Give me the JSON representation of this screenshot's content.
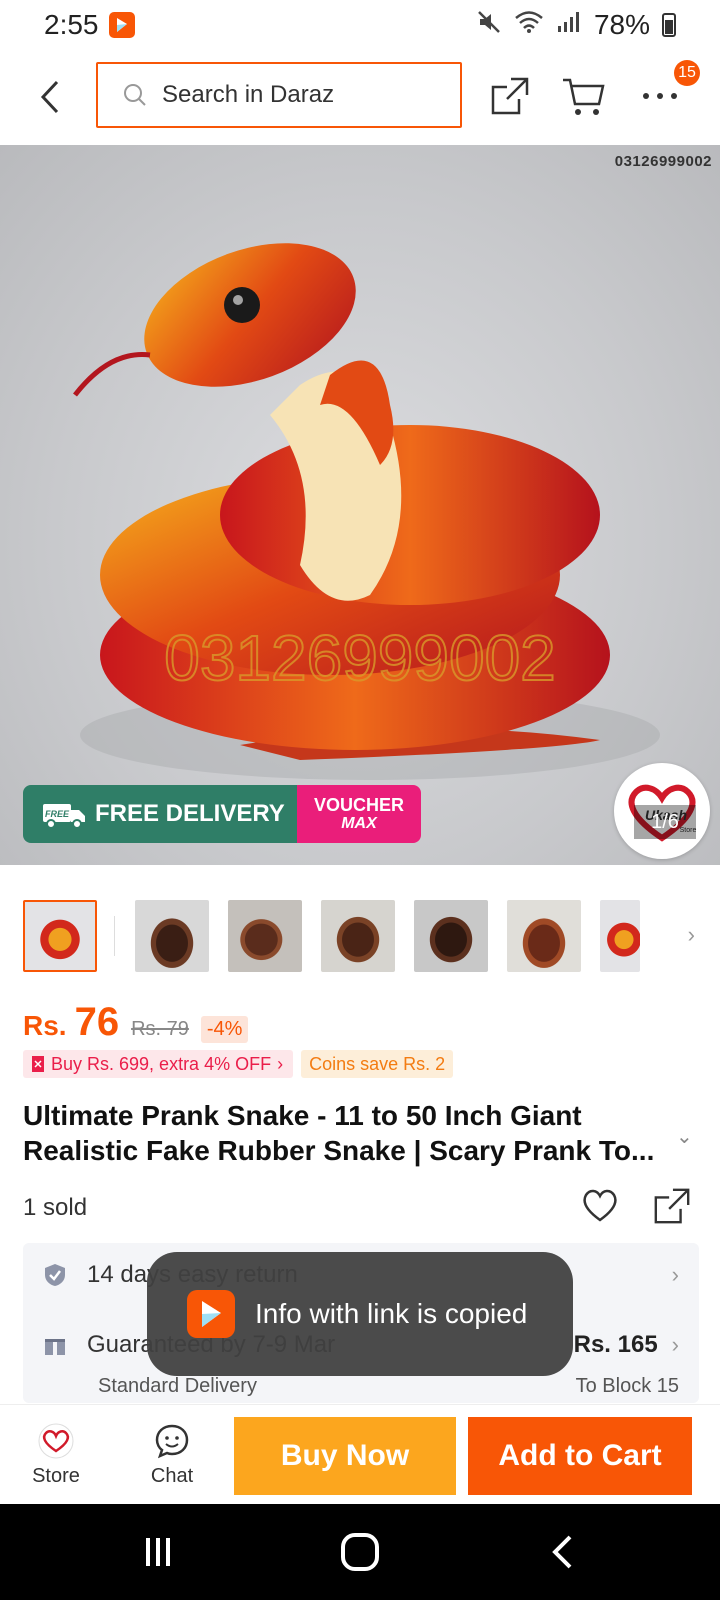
{
  "status": {
    "time": "2:55",
    "battery": "78%"
  },
  "header": {
    "search_placeholder": "Search in Daraz",
    "cart_badge": "15"
  },
  "gallery": {
    "watermark": "03126999002",
    "promo_free": "FREE DELIVERY",
    "promo_free_small": "FREE",
    "promo_voucher_1": "VOUCHER",
    "promo_voucher_2": "MAX",
    "counter": "1/6",
    "store_logo_text": "Ukash",
    "store_logo_sub": "Store"
  },
  "thumbnail_count": 7,
  "product": {
    "currency": "Rs.",
    "price": "76",
    "old_price": "Rs. 79",
    "discount": "-4%",
    "promo_tag": "Buy Rs. 699, extra 4% OFF",
    "coins_tag": "Coins save Rs. 2",
    "title": "Ultimate Prank Snake - 11 to 50 Inch Giant Realistic Fake Rubber Snake | Scary Prank To...",
    "sold": "1 sold"
  },
  "service": {
    "return_text": "14 days easy return",
    "delivery_text": "Guaranteed by 7-9 Mar",
    "delivery_price": "Rs. 165",
    "delivery_type": "Standard Delivery",
    "delivery_to": "To Block 15"
  },
  "toast": {
    "message": "Info with link is copied"
  },
  "action_bar": {
    "store_label": "Store",
    "chat_label": "Chat",
    "buy_now": "Buy Now",
    "add_to_cart": "Add to Cart"
  },
  "colors": {
    "brand": "#f85606",
    "buy_now": "#fca61e",
    "free_delivery": "#2f7e67",
    "voucher": "#ea1e7a"
  }
}
